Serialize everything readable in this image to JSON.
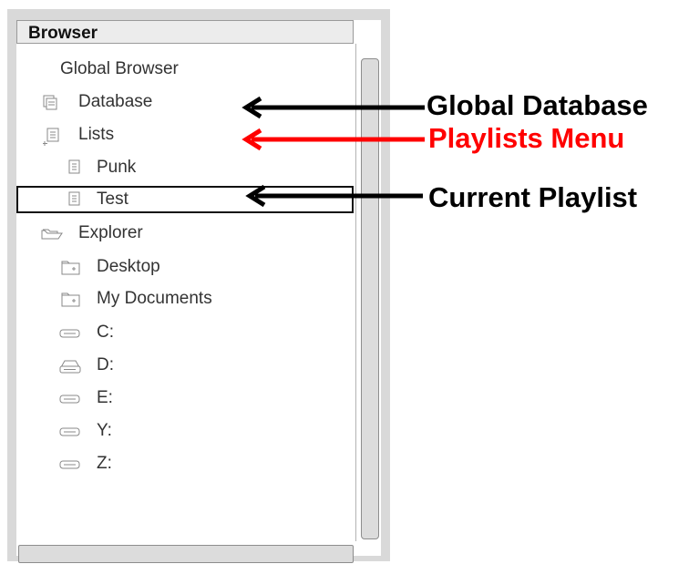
{
  "panel": {
    "title": "Browser"
  },
  "tree": {
    "global_browser": "Global Browser",
    "database": "Database",
    "lists": "Lists",
    "punk": "Punk",
    "test": "Test",
    "explorer": "Explorer",
    "desktop": "Desktop",
    "my_documents": "My Documents",
    "drive_c": "C:",
    "drive_d": "D:",
    "drive_e": "E:",
    "drive_y": "Y:",
    "drive_z": "Z:"
  },
  "annotations": {
    "global_database": "Global Database",
    "playlists_menu": "Playlists Menu",
    "current_playlist": "Current Playlist"
  },
  "colors": {
    "annotation_black": "#000000",
    "annotation_red": "#ff0000"
  },
  "icons": {
    "database": "database-icon",
    "lists": "lists-icon",
    "playlist": "playlist-icon",
    "explorer": "folder-open-icon",
    "folder": "folder-icon",
    "drive": "drive-icon",
    "cd_drive": "cd-drive-icon"
  }
}
